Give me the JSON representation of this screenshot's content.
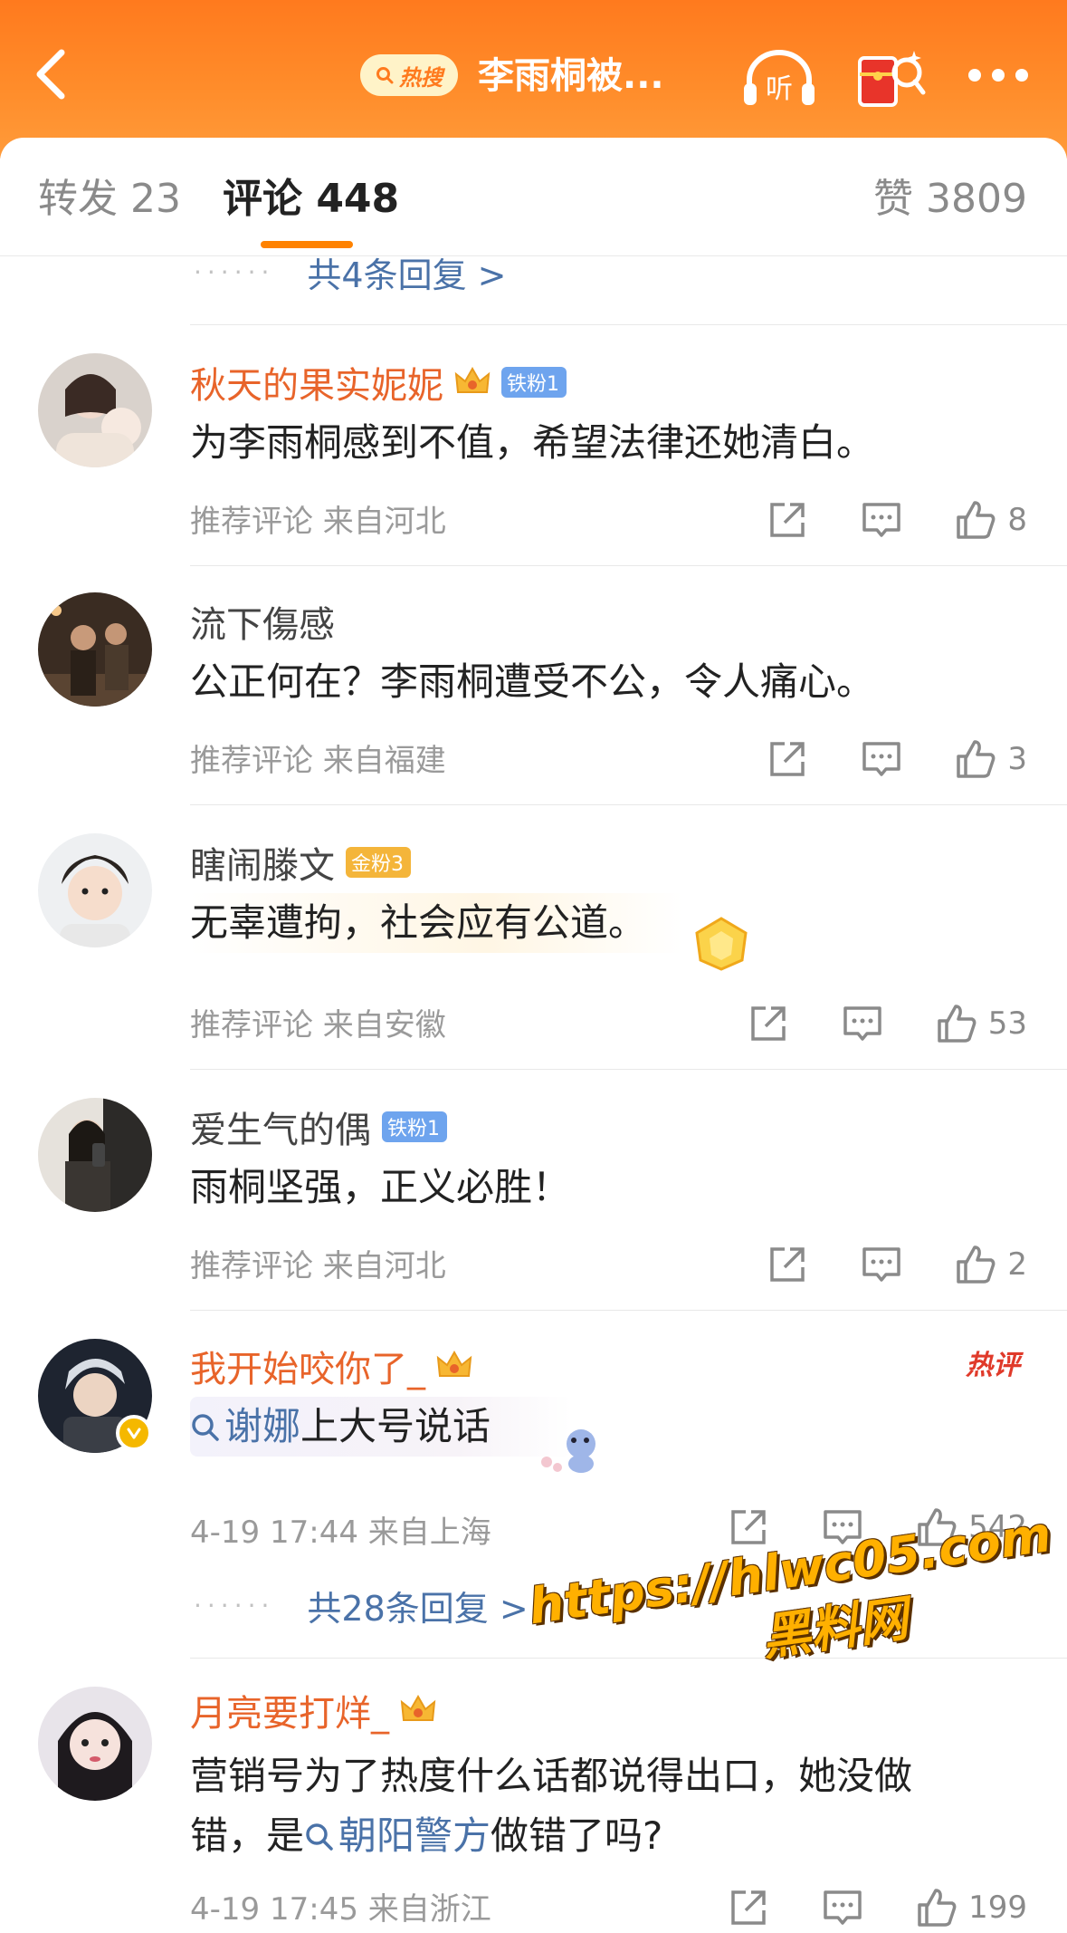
{
  "header": {
    "hot_search_label": "热搜",
    "title": "李雨桐被...",
    "listen_label": "听"
  },
  "tabs": {
    "repost": "转发 23",
    "comments": "评论 448",
    "likes": "赞 3809"
  },
  "top_more_replies": "共4条回复 >",
  "comments": [
    {
      "username": "秋天的果实妮妮",
      "badge": "铁粉1",
      "text": "为李雨桐感到不值，希望法律还她清白。",
      "meta": "推荐评论  来自河北",
      "likes": "8"
    },
    {
      "username": "流下傷感",
      "text": "公正何在？李雨桐遭受不公，令人痛心。",
      "meta": "推荐评论  来自福建",
      "likes": "3"
    },
    {
      "username": "瞎闹滕文",
      "badge": "金粉3",
      "text": "无辜遭拘，社会应有公道。",
      "meta": "推荐评论  来自安徽",
      "likes": "53"
    },
    {
      "username": "爱生气的偶",
      "badge": "铁粉1",
      "text": "雨桐坚强，正义必胜！",
      "meta": "推荐评论  来自河北",
      "likes": "2"
    },
    {
      "username": "我开始咬你了_",
      "hot_label": "热评",
      "link": "谢娜",
      "text_after": "上大号说话",
      "meta": "4-19 17:44  来自上海",
      "likes": "542",
      "more_replies": "共28条回复 >"
    },
    {
      "username": "月亮要打烊_",
      "line1": "营销号为了热度什么话都说得出口，她没做",
      "line2_before": "错，是",
      "link": "朝阳警方",
      "line2_after": "做错了吗?",
      "meta": "4-19 17:45  来自浙江",
      "likes": "199"
    }
  ],
  "watermark": {
    "url": "https://hlwc05.com",
    "site": "黑料网"
  },
  "icons": {
    "share": "share-icon",
    "comment": "comment-icon",
    "like": "thumbs-up-icon"
  },
  "colors": {
    "header_orange": "#ff7a1e",
    "tab_indicator": "#ff8200",
    "username_orange": "#e8642a",
    "link_blue": "#4a72a8",
    "hot_red": "#e03a2a"
  }
}
